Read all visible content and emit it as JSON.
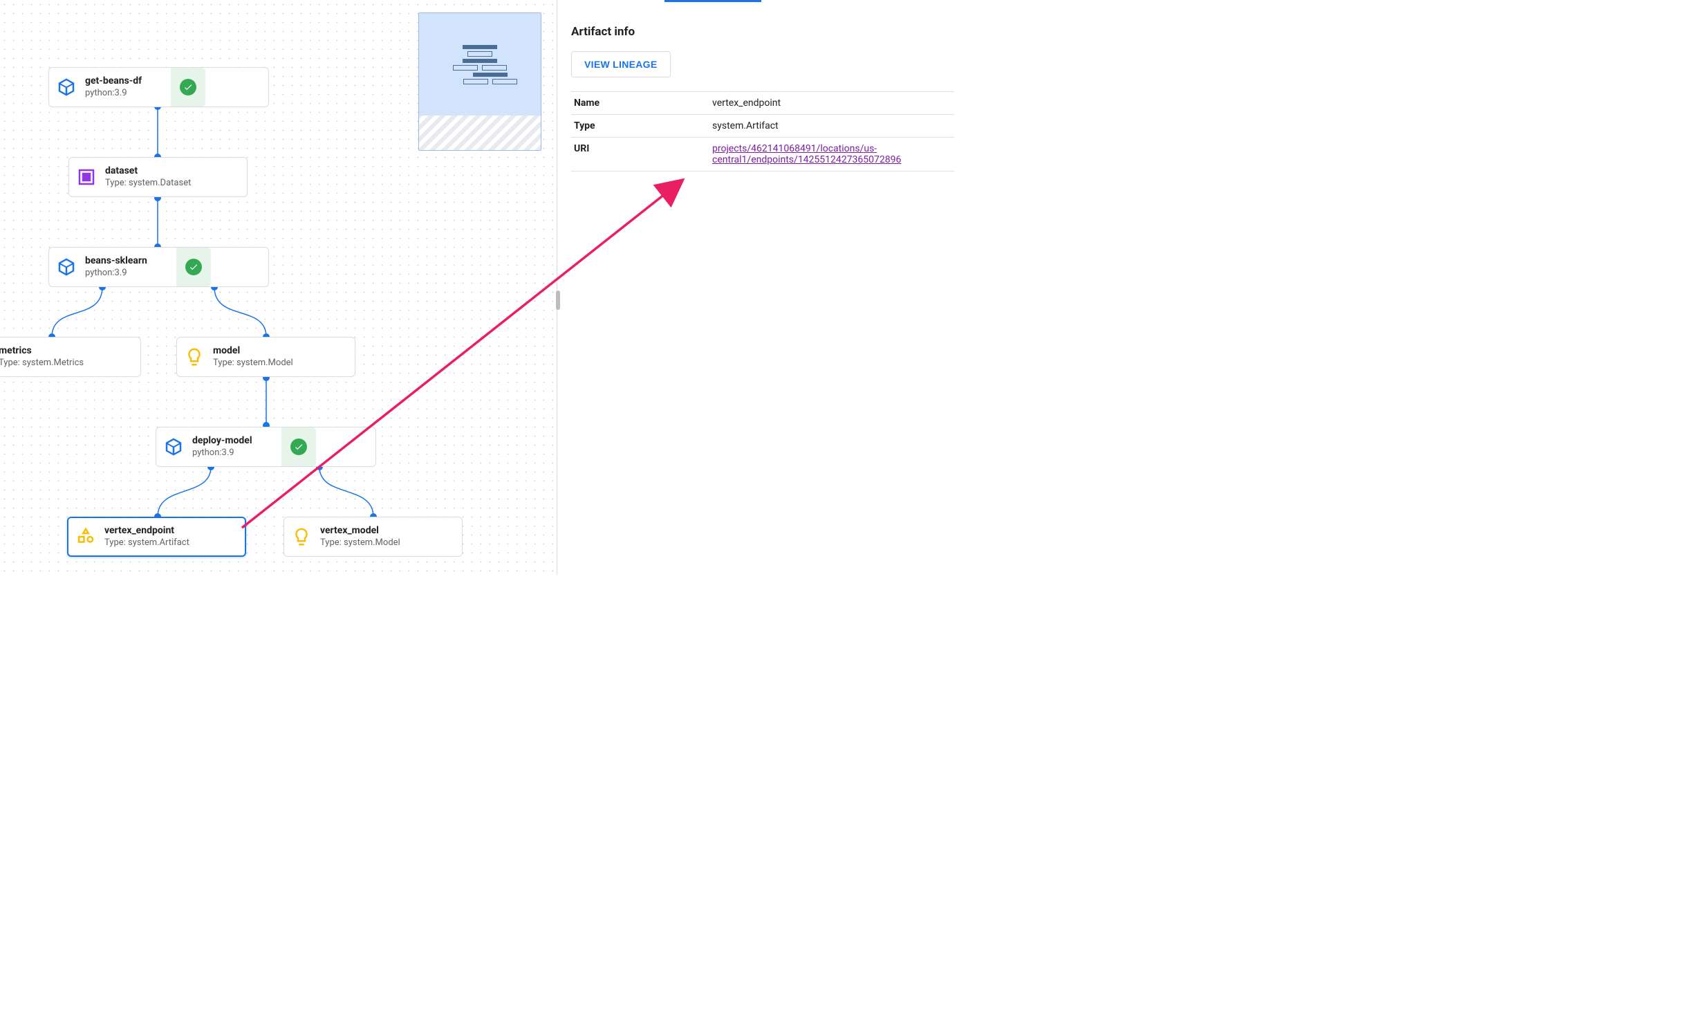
{
  "sidePanel": {
    "title": "Artifact info",
    "viewLineage": "VIEW LINEAGE",
    "rows": {
      "nameKey": "Name",
      "nameVal": "vertex_endpoint",
      "typeKey": "Type",
      "typeVal": "system.Artifact",
      "uriKey": "URI",
      "uriVal": "projects/462141068491/locations/us-central1/endpoints/1425512427365072896"
    }
  },
  "nodes": {
    "getBeans": {
      "title": "get-beans-df",
      "subtitle": "python:3.9"
    },
    "dataset": {
      "title": "dataset",
      "subtitle": "Type: system.Dataset"
    },
    "sklearn": {
      "title": "beans-sklearn",
      "subtitle": "python:3.9"
    },
    "metrics": {
      "title": "metrics",
      "subtitle": "Type: system.Metrics"
    },
    "model": {
      "title": "model",
      "subtitle": "Type: system.Model"
    },
    "deploy": {
      "title": "deploy-model",
      "subtitle": "python:3.9"
    },
    "vEndpoint": {
      "title": "vertex_endpoint",
      "subtitle": "Type: system.Artifact"
    },
    "vModel": {
      "title": "vertex_model",
      "subtitle": "Type: system.Model"
    }
  }
}
